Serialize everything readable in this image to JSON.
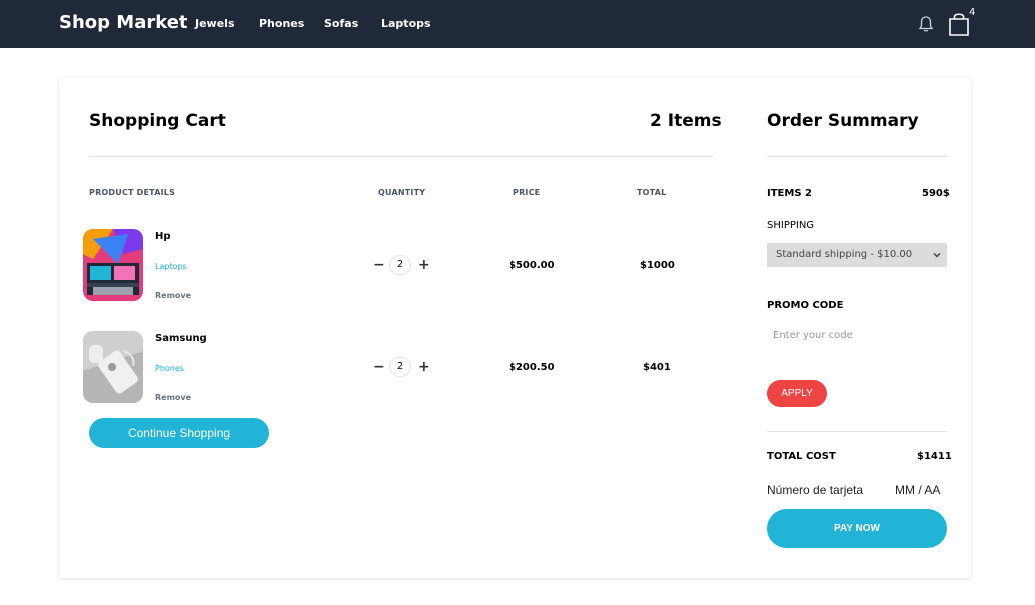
{
  "navbar": {
    "brand": "Shop Market",
    "links": [
      "Jewels",
      "Phones",
      "Sofas",
      "Laptops"
    ],
    "cart_count": "4"
  },
  "cart": {
    "title": "Shopping Cart",
    "items_count_label": "2 Items",
    "columns": [
      "PRODUCT DETAILS",
      "QUANTITY",
      "PRICE",
      "TOTAL"
    ],
    "products": [
      {
        "name": "Hp",
        "category": "Laptops",
        "remove": "Remove",
        "quantity": "2",
        "price": "$500.00",
        "total": "$1000"
      },
      {
        "name": "Samsung",
        "category": "Phones",
        "remove": "Remove",
        "quantity": "2",
        "price": "$200.50",
        "total": "$401"
      }
    ],
    "continue_label": "Continue Shopping"
  },
  "summary": {
    "title": "Order Summary",
    "items_label": "ITEMS 2",
    "items_value": "590$",
    "shipping_label": "SHIPPING",
    "shipping_selected": "Standard shipping - $10.00",
    "promo_label": "PROMO CODE",
    "promo_placeholder": "Enter your code",
    "apply_label": "APPLY",
    "total_label": "TOTAL COST",
    "total_value": "$1411",
    "card_number_label": "Número de tarjeta",
    "card_expiry_label": "MM / AA",
    "pay_label": "PAY NOW"
  },
  "colors": {
    "navbar": "#1f2937",
    "accent": "#22b4d6",
    "apply": "#ef4444"
  }
}
